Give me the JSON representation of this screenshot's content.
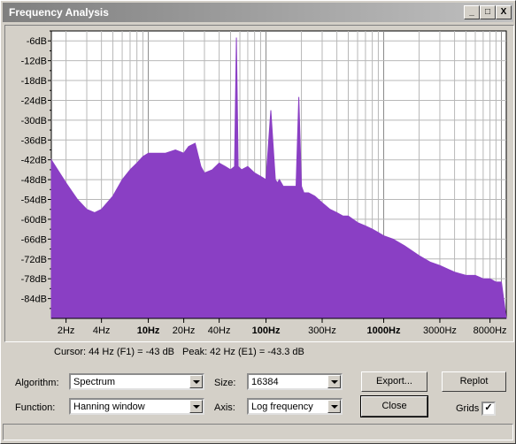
{
  "window": {
    "title": "Frequency Analysis",
    "buttons": {
      "minimize": "_",
      "maximize": "□",
      "close": "X"
    }
  },
  "chart_data": {
    "type": "area",
    "color": "#8a3fc4",
    "x_scale": "log",
    "xlim": [
      1.5,
      11000
    ],
    "ylim": [
      -90,
      -3
    ],
    "grid": true,
    "y_ticks": [
      "-6dB",
      "-12dB",
      "-18dB",
      "-24dB",
      "-30dB",
      "-36dB",
      "-42dB",
      "-48dB",
      "-54dB",
      "-60dB",
      "-66dB",
      "-72dB",
      "-78dB",
      "-84dB"
    ],
    "x_ticks": [
      "2Hz",
      "4Hz",
      "10Hz",
      "20Hz",
      "40Hz",
      "100Hz",
      "300Hz",
      "1000Hz",
      "3000Hz",
      "8000Hz"
    ],
    "series": [
      {
        "x": [
          1.5,
          2,
          2.5,
          3,
          3.5,
          4,
          5,
          6,
          7,
          8,
          9,
          10,
          12,
          14,
          17,
          20,
          22,
          25,
          28,
          30,
          35,
          40,
          45,
          50,
          54,
          56,
          58,
          62,
          70,
          80,
          90,
          100,
          110,
          120,
          125,
          130,
          140,
          160,
          180,
          190,
          200,
          210,
          230,
          260,
          300,
          350,
          400,
          450,
          500,
          600,
          700,
          800,
          900,
          1000,
          1200,
          1500,
          2000,
          2500,
          3000,
          4000,
          5000,
          6000,
          7000,
          8000,
          9000,
          10000,
          11000
        ],
        "y": [
          -42,
          -49,
          -54,
          -57,
          -58,
          -57,
          -53,
          -48,
          -45,
          -43,
          -41,
          -40,
          -40,
          -40,
          -39,
          -40,
          -38,
          -37,
          -44,
          -46,
          -45,
          -43,
          -44,
          -45,
          -44,
          -5,
          -44,
          -45,
          -44,
          -46,
          -47,
          -48,
          -27,
          -48,
          -49,
          -48,
          -50,
          -50,
          -50,
          -23,
          -50,
          -52,
          -52,
          -53,
          -55,
          -57,
          -58,
          -59,
          -59,
          -61,
          -62,
          -63,
          -64,
          -65,
          -66,
          -68,
          -71,
          -73,
          -74,
          -76,
          -77,
          -77,
          -78,
          -78,
          -79,
          -79,
          -90
        ]
      }
    ]
  },
  "cursor_text": "Cursor: 44 Hz (F1) = -43 dB",
  "peak_text": "Peak: 42 Hz (E1) = -43.3 dB",
  "controls": {
    "algorithm_label": "Algorithm:",
    "algorithm_value": "Spectrum",
    "function_label": "Function:",
    "function_value": "Hanning window",
    "size_label": "Size:",
    "size_value": "16384",
    "axis_label": "Axis:",
    "axis_value": "Log frequency",
    "export_label": "Export...",
    "replot_label": "Replot",
    "close_label": "Close",
    "grids_label": "Grids",
    "grids_checked": "✓"
  }
}
